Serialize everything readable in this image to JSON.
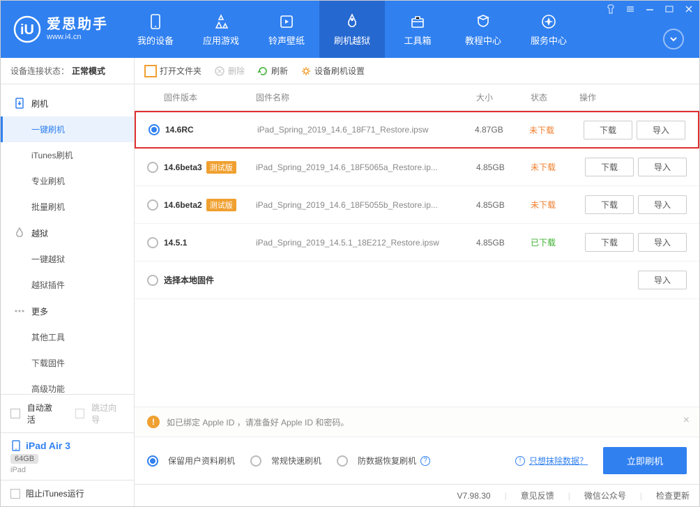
{
  "logo": {
    "title": "爱思助手",
    "subtitle": "www.i4.cn"
  },
  "topTabs": {
    "items": [
      {
        "label": "我的设备"
      },
      {
        "label": "应用游戏"
      },
      {
        "label": "铃声壁纸"
      },
      {
        "label": "刷机越狱"
      },
      {
        "label": "工具箱"
      },
      {
        "label": "教程中心"
      },
      {
        "label": "服务中心"
      }
    ]
  },
  "connStatus": {
    "prefix": "设备连接状态：",
    "value": "正常模式"
  },
  "toolbar": {
    "openFolder": "打开文件夹",
    "delete": "删除",
    "refresh": "刷新",
    "deviceSettings": "设备刷机设置"
  },
  "sidebar": {
    "groups": [
      {
        "label": "刷机",
        "items": [
          "一键刷机",
          "iTunes刷机",
          "专业刷机",
          "批量刷机"
        ]
      },
      {
        "label": "越狱",
        "items": [
          "一键越狱",
          "越狱插件"
        ]
      },
      {
        "label": "更多",
        "items": [
          "其他工具",
          "下载固件",
          "高级功能"
        ]
      }
    ],
    "autoActivate": "自动激活",
    "skipWizard": "跳过向导",
    "device": {
      "name": "iPad Air 3",
      "storage": "64GB",
      "type": "iPad"
    },
    "blockItunes": "阻止iTunes运行"
  },
  "tableHead": {
    "version": "固件版本",
    "name": "固件名称",
    "size": "大小",
    "status": "状态",
    "ops": "操作"
  },
  "rows": [
    {
      "selected": true,
      "version": "14.6RC",
      "beta": false,
      "name": "iPad_Spring_2019_14.6_18F71_Restore.ipsw",
      "size": "4.87GB",
      "status": "未下载",
      "statusColor": "orange",
      "download": true,
      "import": true
    },
    {
      "selected": false,
      "version": "14.6beta3",
      "beta": true,
      "name": "iPad_Spring_2019_14.6_18F5065a_Restore.ip...",
      "size": "4.85GB",
      "status": "未下载",
      "statusColor": "orange",
      "download": true,
      "import": true
    },
    {
      "selected": false,
      "version": "14.6beta2",
      "beta": true,
      "name": "iPad_Spring_2019_14.6_18F5055b_Restore.ip...",
      "size": "4.85GB",
      "status": "未下载",
      "statusColor": "orange",
      "download": true,
      "import": true
    },
    {
      "selected": false,
      "version": "14.5.1",
      "beta": false,
      "name": "iPad_Spring_2019_14.5.1_18E212_Restore.ipsw",
      "size": "4.85GB",
      "status": "已下载",
      "statusColor": "green",
      "download": true,
      "import": true
    },
    {
      "selected": false,
      "version": "选择本地固件",
      "beta": false,
      "name": "",
      "size": "",
      "status": "",
      "statusColor": "",
      "download": false,
      "import": true
    }
  ],
  "betaBadge": "测试版",
  "buttons": {
    "download": "下载",
    "import": "导入"
  },
  "notice": "如已绑定 Apple ID ，请准备好 Apple ID 和密码。",
  "options": {
    "items": [
      "保留用户资料刷机",
      "常规快速刷机",
      "防数据恢复刷机"
    ],
    "eraseLink": "只想抹除数据？",
    "flashNow": "立即刷机"
  },
  "statusbar": {
    "version": "V7.98.30",
    "feedback": "意见反馈",
    "wechat": "微信公众号",
    "checkUpdate": "检查更新"
  }
}
